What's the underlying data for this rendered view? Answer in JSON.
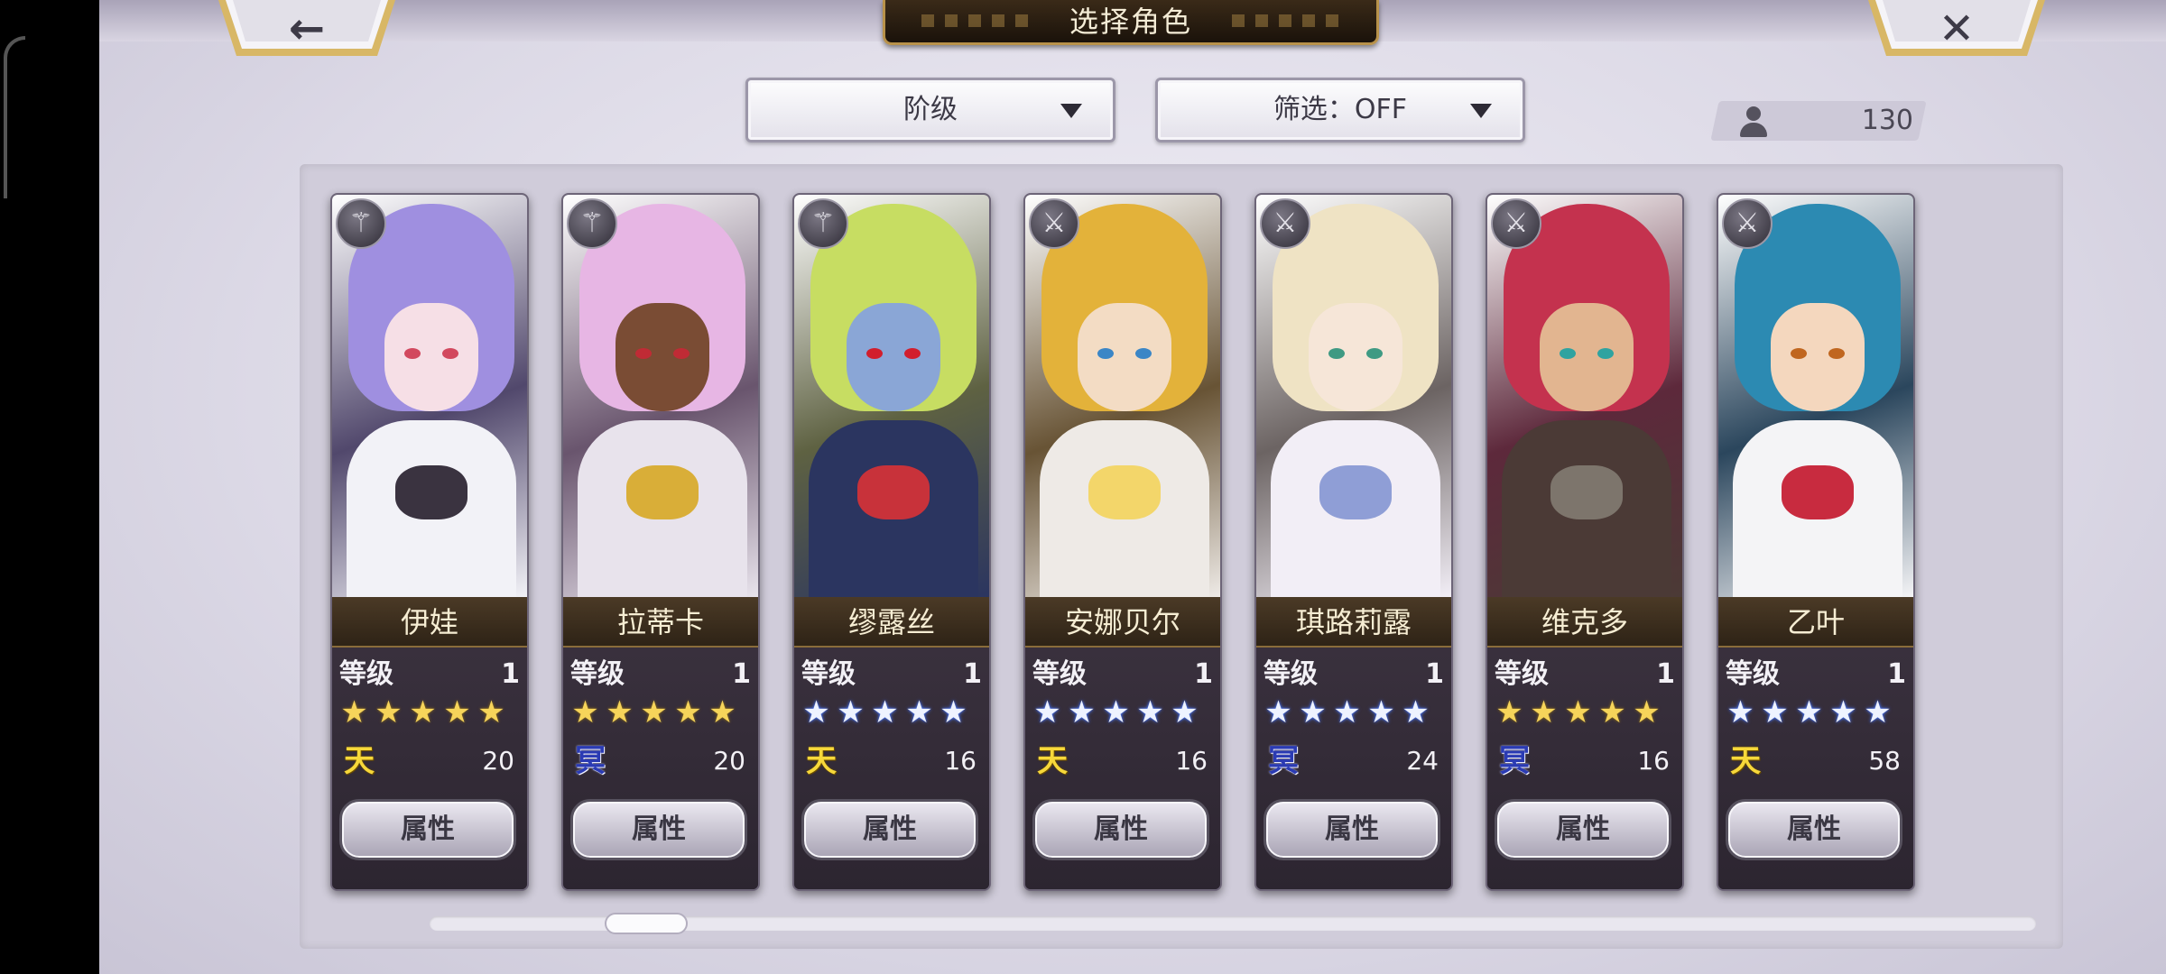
{
  "header": {
    "title": "选择角色",
    "back_icon": "left-arrow-icon",
    "close_icon": "close-x-icon",
    "back_glyph": "←",
    "close_glyph": "✕"
  },
  "filters": {
    "sort_label": "阶级",
    "filter_label": "筛选：OFF"
  },
  "roster": {
    "count": "130",
    "icon": "person-icon"
  },
  "labels": {
    "level": "等级",
    "attribute_button": "属性"
  },
  "characters": [
    {
      "name": "伊娃",
      "level": "1",
      "stars": 5,
      "star_color": "gold",
      "element": "天",
      "element_type": "sky",
      "cost": "20",
      "class_icon": "staff-icon",
      "class_glyph": "⚚",
      "colors": {
        "hair": "#9f8fe0",
        "skin": "#f6dfe6",
        "torso": "#f2f2f7",
        "accent": "#3a3340",
        "eye": "#d2485e"
      }
    },
    {
      "name": "拉蒂卡",
      "level": "1",
      "stars": 5,
      "star_color": "gold",
      "element": "冥",
      "element_type": "dark",
      "cost": "20",
      "class_icon": "staff-icon",
      "class_glyph": "⚚",
      "colors": {
        "hair": "#e7b6e4",
        "skin": "#7a4c34",
        "torso": "#e8e3ec",
        "accent": "#d9ae38",
        "eye": "#c02b35"
      }
    },
    {
      "name": "缪露丝",
      "level": "1",
      "stars": 5,
      "star_color": "blue",
      "element": "天",
      "element_type": "sky",
      "cost": "16",
      "class_icon": "staff-icon",
      "class_glyph": "⚚",
      "colors": {
        "hair": "#c7dd62",
        "skin": "#8aa6d6",
        "torso": "#2b3560",
        "accent": "#c8323a",
        "eye": "#d21e2d"
      }
    },
    {
      "name": "安娜贝尔",
      "level": "1",
      "stars": 5,
      "star_color": "blue",
      "element": "天",
      "element_type": "sky",
      "cost": "16",
      "class_icon": "sword-icon",
      "class_glyph": "⚔",
      "colors": {
        "hair": "#e3b23a",
        "skin": "#f3dcc4",
        "torso": "#eeeae6",
        "accent": "#f3d66a",
        "eye": "#3b86c6"
      }
    },
    {
      "name": "琪路莉露",
      "level": "1",
      "stars": 5,
      "star_color": "blue",
      "element": "冥",
      "element_type": "dark",
      "cost": "24",
      "class_icon": "sword-icon",
      "class_glyph": "⚔",
      "colors": {
        "hair": "#efe3c4",
        "skin": "#f6e6d8",
        "torso": "#f2eef6",
        "accent": "#8f9ed6",
        "eye": "#3f9a83"
      }
    },
    {
      "name": "维克多",
      "level": "1",
      "stars": 5,
      "star_color": "gold",
      "element": "冥",
      "element_type": "dark",
      "cost": "16",
      "class_icon": "sword-icon",
      "class_glyph": "⚔",
      "colors": {
        "hair": "#c4324e",
        "skin": "#e2b590",
        "torso": "#4b3a36",
        "accent": "#7d756c",
        "eye": "#2fa3a0"
      }
    },
    {
      "name": "乙叶",
      "level": "1",
      "stars": 5,
      "star_color": "blue",
      "element": "天",
      "element_type": "sky",
      "cost": "58",
      "class_icon": "sword-icon",
      "class_glyph": "⚔",
      "colors": {
        "hair": "#2c8ab2",
        "skin": "#f4d7be",
        "torso": "#f4f4f6",
        "accent": "#c82b3f",
        "eye": "#c0661f"
      }
    }
  ]
}
